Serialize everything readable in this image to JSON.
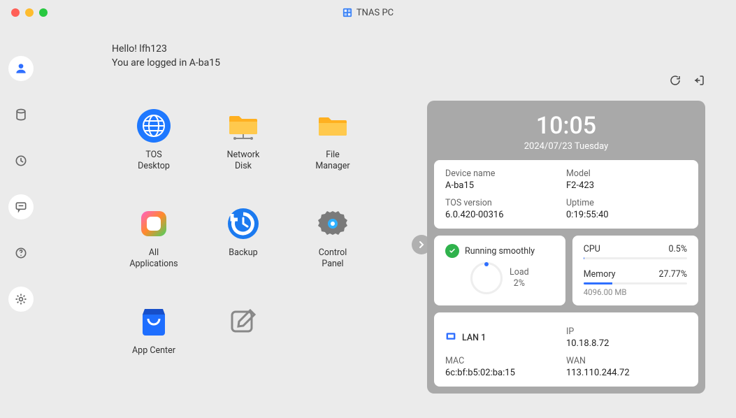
{
  "title": "TNAS PC",
  "greeting": {
    "hello": "Hello! lfh123",
    "logged": "You are logged in A-ba15"
  },
  "sidebar": {
    "user": "user",
    "disk": "disk",
    "history": "history",
    "chat": "chat",
    "help": "help",
    "settings": "settings"
  },
  "apps": {
    "tos_desktop": "TOS\nDesktop",
    "network_disk": "Network\nDisk",
    "file_manager": "File\nManager",
    "all_applications": "All\nApplications",
    "backup": "Backup",
    "control_panel": "Control\nPanel",
    "app_center": "App Center",
    "edit": ""
  },
  "dash": {
    "time": "10:05",
    "date": "2024/07/23 Tuesday",
    "device": {
      "device_name_lbl": "Device name",
      "device_name_val": "A-ba15",
      "model_lbl": "Model",
      "model_val": "F2-423",
      "tos_ver_lbl": "TOS version",
      "tos_ver_val": "6.0.420-00316",
      "uptime_lbl": "Uptime",
      "uptime_val": "0:19:55:40"
    },
    "status": {
      "text": "Running smoothly",
      "load_lbl": "Load",
      "load_val": "2%"
    },
    "cpu": {
      "cpu_lbl": "CPU",
      "cpu_val": "0.5%",
      "mem_lbl": "Memory",
      "mem_val": "27.77%",
      "mem_total": "4096.00 MB"
    },
    "net": {
      "lan": "LAN 1",
      "ip_lbl": "IP",
      "ip_val": "10.18.8.72",
      "mac_lbl": "MAC",
      "mac_val": "6c:bf:b5:02:ba:15",
      "wan_lbl": "WAN",
      "wan_val": "113.110.244.72"
    }
  },
  "colors": {
    "accent": "#2f6fff"
  }
}
